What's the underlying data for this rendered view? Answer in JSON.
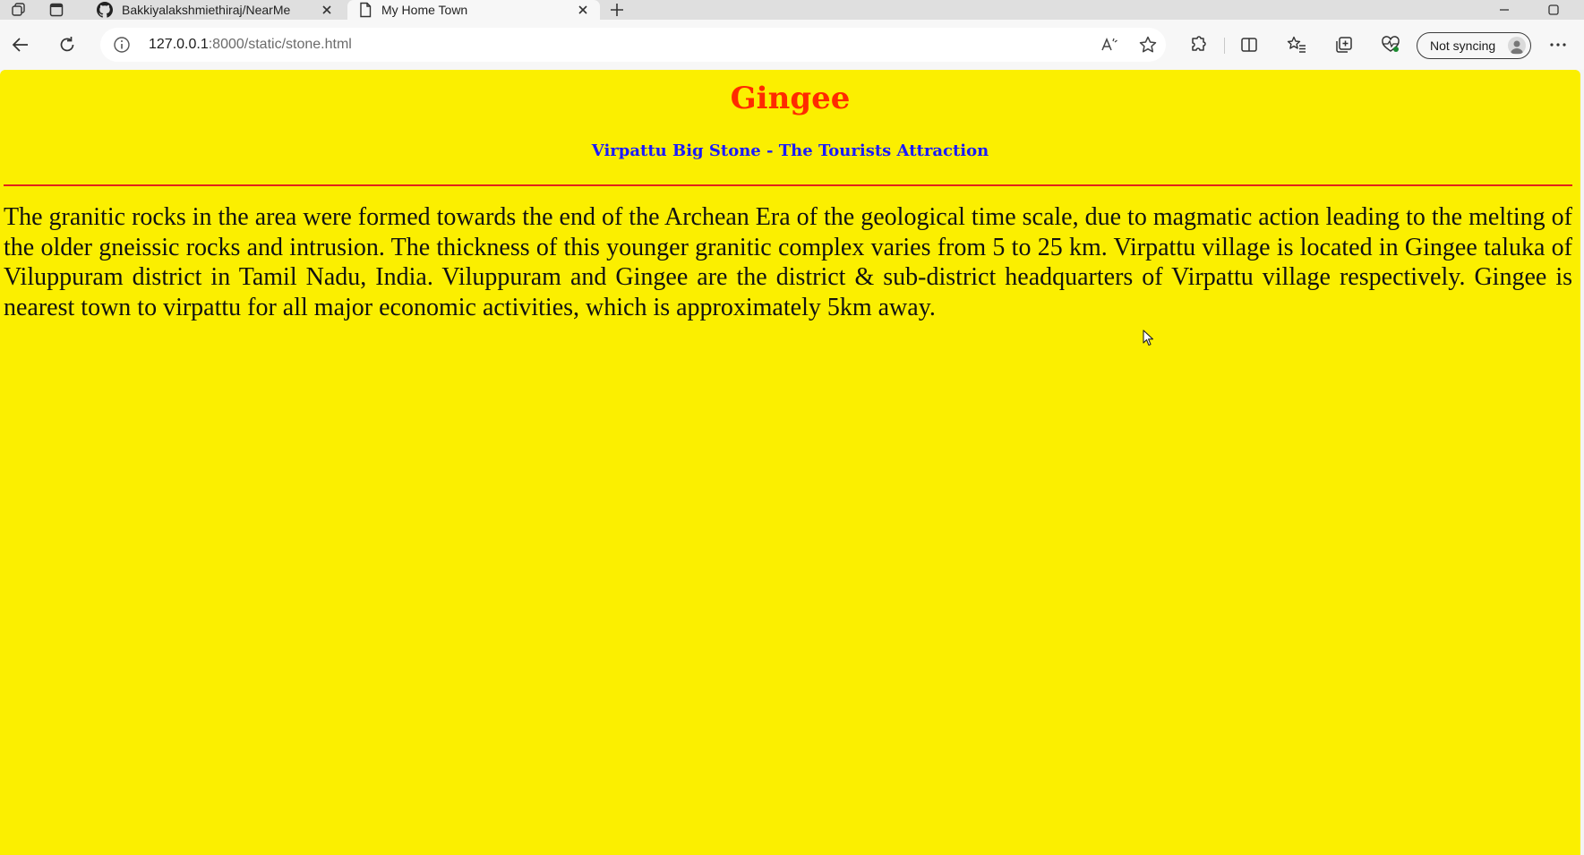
{
  "browser": {
    "tabs": [
      {
        "title": "Bakkiyalakshmiethiraj/NearMe",
        "icon": "github-icon",
        "active": false
      },
      {
        "title": "My Home Town",
        "icon": "page-icon",
        "active": true
      }
    ],
    "url_host": "127.0.0.1",
    "url_path": ":8000/static/stone.html",
    "profile_label": "Not syncing",
    "toolbar_icons": [
      "back-icon",
      "refresh-icon",
      "info-icon",
      "read-aloud-icon",
      "favorite-star-icon",
      "extensions-icon",
      "split-screen-icon",
      "favorites-icon",
      "collections-icon",
      "browser-essentials-icon",
      "more-icon"
    ]
  },
  "page": {
    "background": "#fbef00",
    "title": "Gingee",
    "title_color": "#ff2a00",
    "subtitle": "Virpattu Big Stone - The Tourists Attraction",
    "subtitle_color": "#1a1aff",
    "rule_color": "#e2231a",
    "paragraph": "The granitic rocks in the area were formed towards the end of the Archean Era of the geological time scale, due to magmatic action leading to the melting of the older gneissic rocks and intrusion. The thickness of this younger granitic complex varies from 5 to 25 km. Virpattu village is located in Gingee taluka of Viluppuram district in Tamil Nadu, India. Viluppuram and Gingee are the district & sub-district headquarters of Virpattu village respectively. Gingee is nearest town to virpattu for all major economic activities, which is approximately 5km away."
  }
}
